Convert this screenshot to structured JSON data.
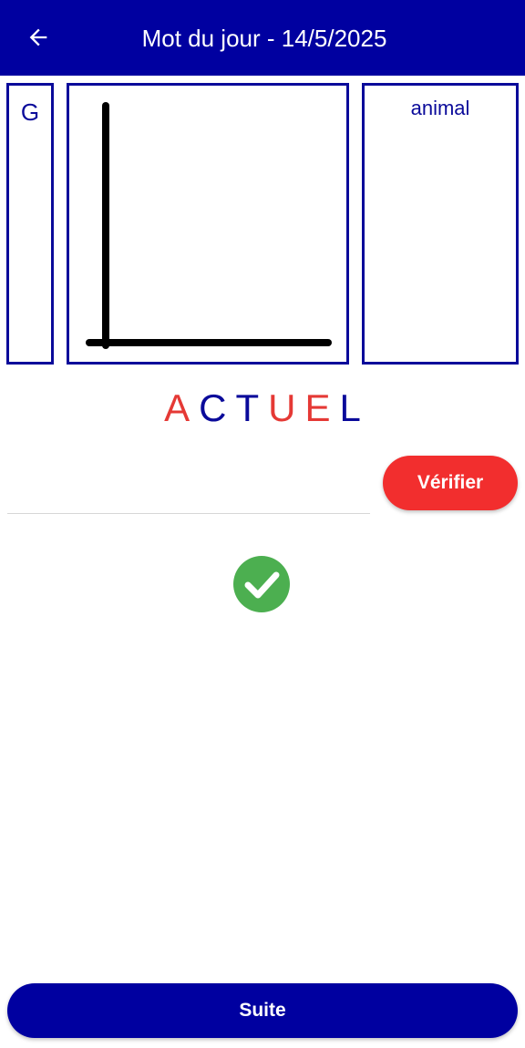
{
  "header": {
    "title": "Mot du jour - 14/5/2025",
    "back_icon": "arrow-left-icon",
    "background_color": "#0000A0"
  },
  "cards": {
    "letter": "G",
    "category": "animal",
    "drawing_icon": "letter-L-drawing"
  },
  "word": {
    "letters": [
      {
        "char": "A",
        "color": "#E53935"
      },
      {
        "char": "C",
        "color": "#0A0A9A"
      },
      {
        "char": "T",
        "color": "#0A0A9A"
      },
      {
        "char": "U",
        "color": "#E53935"
      },
      {
        "char": "E",
        "color": "#E53935"
      },
      {
        "char": "L",
        "color": "#0A0A9A"
      }
    ]
  },
  "answer": {
    "value": "",
    "placeholder": ""
  },
  "buttons": {
    "verify_label": "Vérifier",
    "verify_color": "#F22E2E",
    "next_label": "Suite",
    "next_color": "#0000A0"
  },
  "result": {
    "icon": "check-circle-icon",
    "color": "#4CAF50"
  }
}
